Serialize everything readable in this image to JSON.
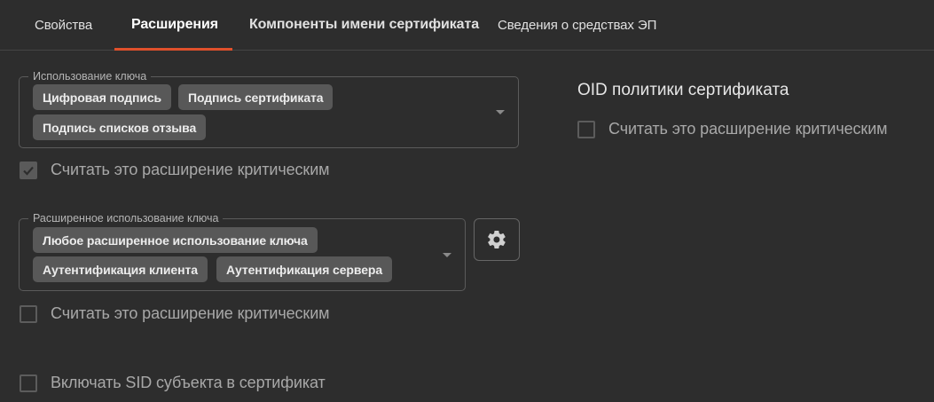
{
  "tabs": [
    {
      "label": "Свойства"
    },
    {
      "label": "Расширения"
    },
    {
      "label": "Компоненты имени сертификата"
    },
    {
      "label": "Сведения о средствах ЭП"
    }
  ],
  "key_usage": {
    "legend": "Использование ключа",
    "chips": [
      "Цифровая подпись",
      "Подпись сертификата",
      "Подпись списков отзыва"
    ],
    "critical_label": "Считать это расширение критическим",
    "critical_checked": true
  },
  "extended_key_usage": {
    "legend": "Расширенное использование ключа",
    "chips": [
      "Любое расширенное использование ключа",
      "Аутентификация клиента",
      "Аутентификация сервера"
    ],
    "critical_label": "Считать это расширение критическим",
    "critical_checked": false,
    "settings_icon": "gear-icon"
  },
  "include_sid": {
    "label": "Включать SID субъекта в сертификат",
    "checked": false
  },
  "policy_oid": {
    "title": "OID политики сертификата",
    "critical_label": "Считать это расширение критическим",
    "critical_checked": false
  },
  "colors": {
    "background": "#2d2d2d",
    "accent": "#e0502b",
    "chip": "#585858",
    "border": "#5b5b5b"
  }
}
